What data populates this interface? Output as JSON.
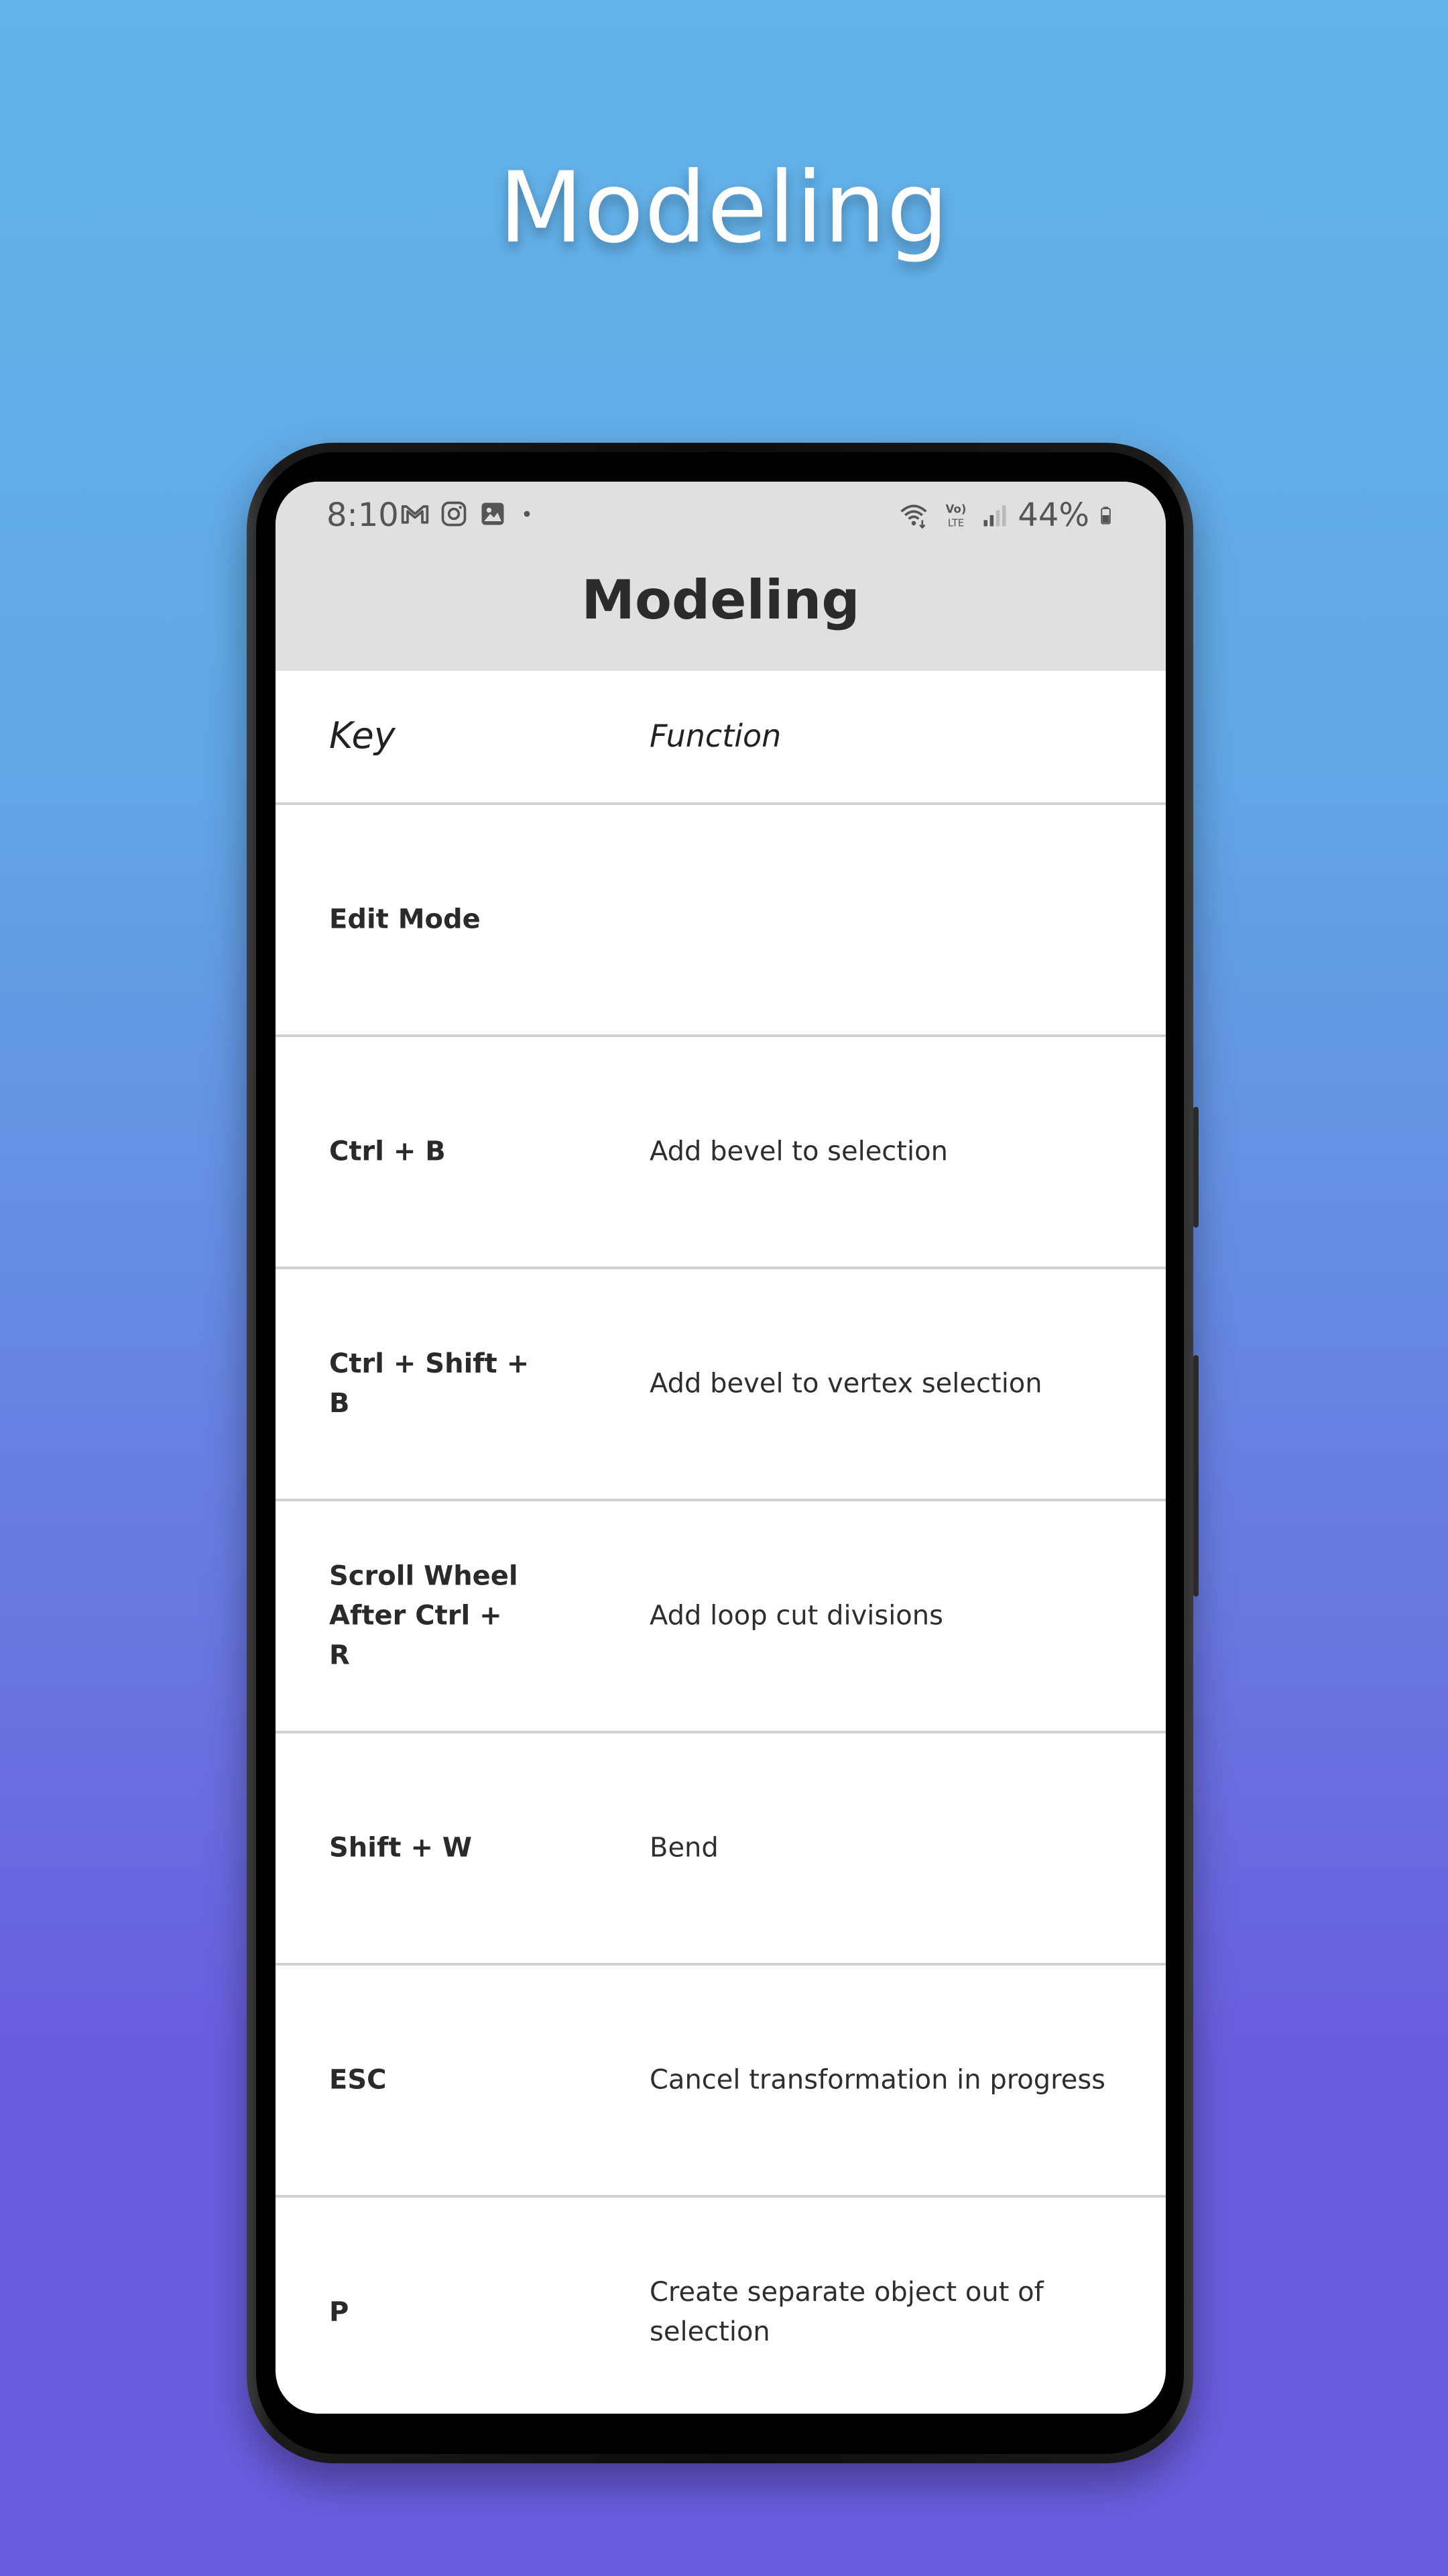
{
  "hero": {
    "title": "Modeling"
  },
  "status_bar": {
    "time": "8:10",
    "battery": "44%",
    "left_icons": [
      "gmail-icon",
      "instagram-icon",
      "gallery-icon",
      "dot-icon"
    ],
    "right_icons": [
      "wifi-icon",
      "volte-icon",
      "signal-icon",
      "battery-icon"
    ]
  },
  "appbar": {
    "title": "Modeling"
  },
  "table": {
    "headers": {
      "key": "Key",
      "function": "Function"
    },
    "rows": [
      {
        "key": "Edit Mode",
        "function": ""
      },
      {
        "key": "Ctrl + B",
        "function": "Add bevel to selection"
      },
      {
        "key": "Ctrl + Shift + B",
        "function": "Add bevel to vertex selection"
      },
      {
        "key": "Scroll Wheel After Ctrl + R",
        "function": "Add loop cut divisions"
      },
      {
        "key": "Shift + W",
        "function": "Bend"
      },
      {
        "key": "ESC",
        "function": "Cancel transformation in progress"
      },
      {
        "key": "P",
        "function": "Create separate object out of selection"
      }
    ]
  },
  "colors": {
    "gradient_top": "#62b3e8",
    "gradient_bottom": "#6a5ddf",
    "appbar_bg": "#e0e0e0",
    "divider": "#d0d0d0"
  }
}
